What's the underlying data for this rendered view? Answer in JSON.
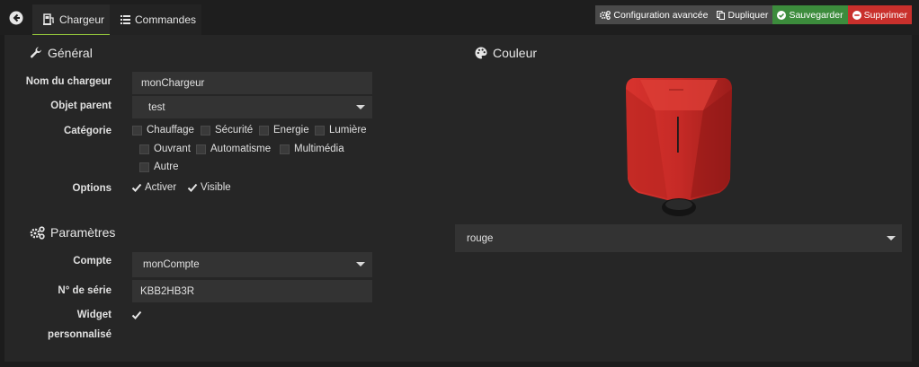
{
  "tabs": {
    "chargeur": "Chargeur",
    "commandes": "Commandes"
  },
  "actions": {
    "config": "Configuration avancée",
    "duplicate": "Dupliquer",
    "save": "Sauvegarder",
    "delete": "Supprimer"
  },
  "general": {
    "title": "Général",
    "name_label": "Nom du chargeur",
    "name_value": "monChargeur",
    "parent_label": "Objet parent",
    "parent_value": "test",
    "category_label": "Catégorie",
    "categories": [
      "Chauffage",
      "Sécurité",
      "Energie",
      "Lumière",
      "Ouvrant",
      "Automatisme",
      "Multimédia",
      "Autre"
    ],
    "options_label": "Options",
    "options": [
      "Activer",
      "Visible"
    ]
  },
  "params": {
    "title": "Paramètres",
    "account_label": "Compte",
    "account_value": "monCompte",
    "serial_label": "N° de série",
    "serial_value": "KBB2HB3R",
    "widget_label_1": "Widget",
    "widget_label_2": "personnalisé"
  },
  "color": {
    "title": "Couleur",
    "value": "rouge",
    "charger_color": "#c62a26"
  },
  "colors": {
    "accent": "#94c73b",
    "save": "#3c8c3c",
    "delete": "#c9302c",
    "neutral": "#4a4a4a"
  }
}
